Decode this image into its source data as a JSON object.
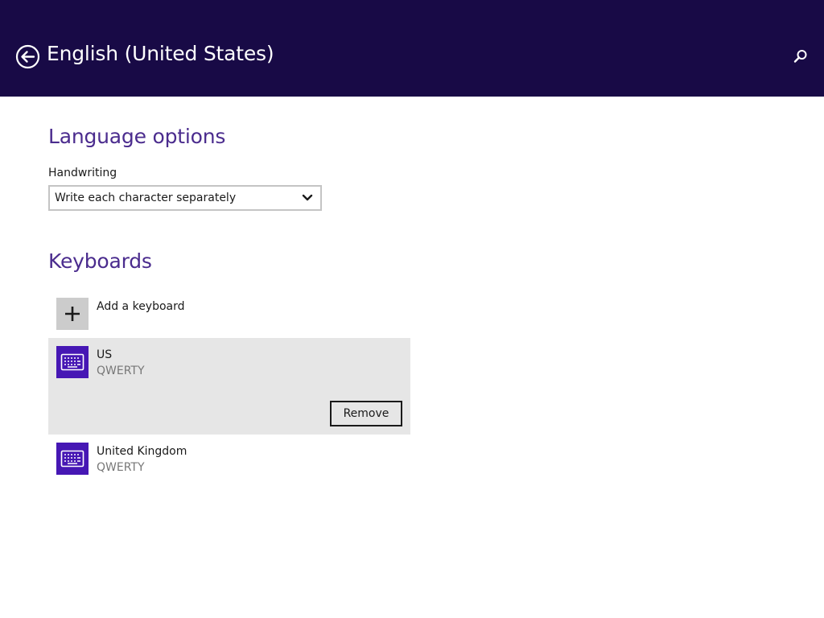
{
  "header": {
    "title": "English (United States)",
    "back_icon": "back-arrow-circle-icon",
    "search_icon": "search-icon",
    "background": "#180a46"
  },
  "language_options": {
    "title": "Language options",
    "handwriting_label": "Handwriting",
    "handwriting_value": "Write each character separately"
  },
  "keyboards": {
    "title": "Keyboards",
    "add_label": "Add a keyboard",
    "items": [
      {
        "name": "US",
        "layout": "QWERTY",
        "selected": true,
        "remove_label": "Remove"
      },
      {
        "name": "United Kingdom",
        "layout": "QWERTY",
        "selected": false
      }
    ]
  },
  "colors": {
    "accent": "#4b2c8e",
    "tile": "#4617b4",
    "selected_row": "#e6e6e6"
  }
}
